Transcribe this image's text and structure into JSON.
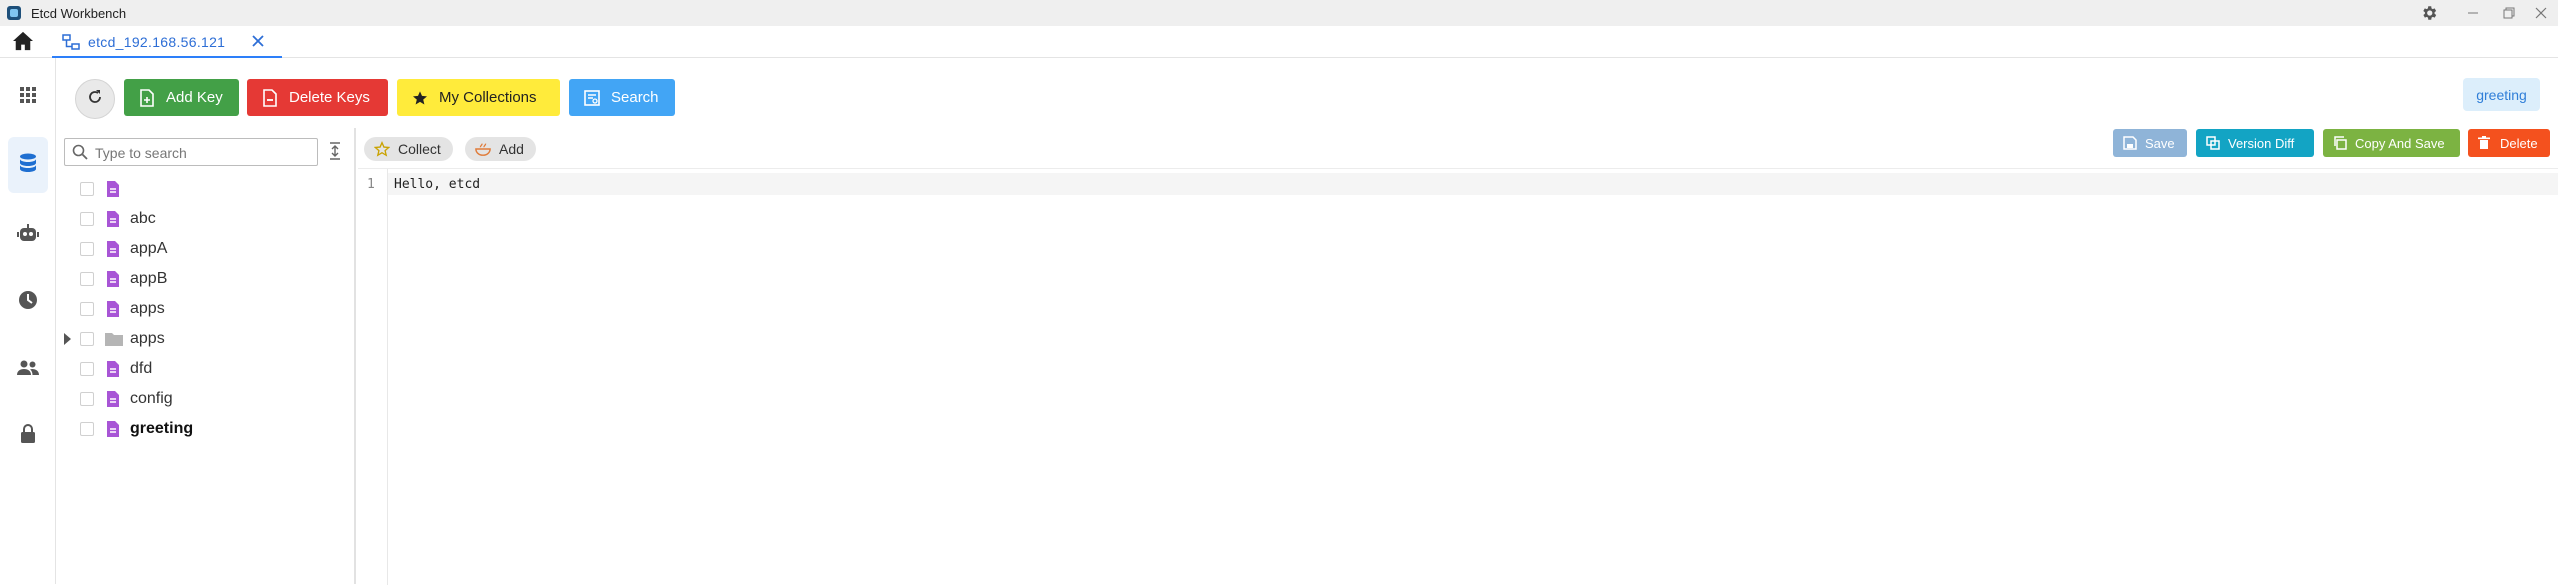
{
  "window": {
    "title": "Etcd Workbench"
  },
  "tabs": [
    {
      "label": "etcd_192.168.56.121"
    }
  ],
  "toolbar": {
    "add_key": "Add Key",
    "delete_keys": "Delete Keys",
    "my_collections": "My Collections",
    "search": "Search"
  },
  "selected_key": "greeting",
  "tree": {
    "search_placeholder": "Type to search",
    "items": [
      {
        "label": "",
        "type": "file"
      },
      {
        "label": "abc",
        "type": "file"
      },
      {
        "label": "appA",
        "type": "file"
      },
      {
        "label": "appB",
        "type": "file"
      },
      {
        "label": "apps",
        "type": "file"
      },
      {
        "label": "apps",
        "type": "folder"
      },
      {
        "label": "dfd",
        "type": "file"
      },
      {
        "label": "config",
        "type": "file"
      },
      {
        "label": "greeting",
        "type": "file"
      }
    ]
  },
  "editor": {
    "collect_label": "Collect",
    "add_label": "Add",
    "save_label": "Save",
    "version_diff_label": "Version Diff",
    "copy_and_save_label": "Copy And Save",
    "delete_label": "Delete",
    "line_number": "1",
    "content": "Hello, etcd"
  },
  "colors": {
    "add_key": "#43a047",
    "delete_keys": "#e53935",
    "my_collections": "#ffeb3b",
    "search": "#42a5f5",
    "save": "#8fb4d8",
    "version_diff": "#13a4c4",
    "copy_and_save": "#7cb342",
    "delete": "#f4511e",
    "tab_accent": "#2d7ff9",
    "file_icon": "#a855d6",
    "folder_icon": "#b5b5b5"
  },
  "icons": {
    "home": "home-icon",
    "refresh": "refresh-icon",
    "settings": "gear-icon"
  }
}
